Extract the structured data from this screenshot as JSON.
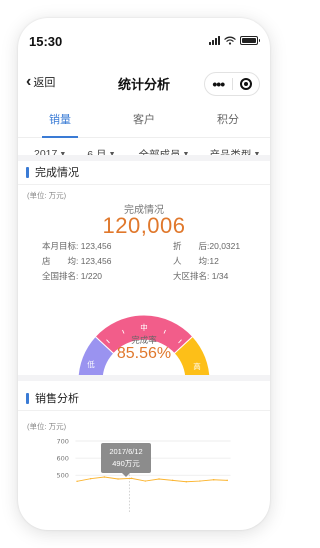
{
  "status_bar": {
    "time": "15:30"
  },
  "nav": {
    "back_label": "返回",
    "title": "统计分析",
    "more_glyph": "•••"
  },
  "tabs": [
    {
      "label": "销量",
      "active": true
    },
    {
      "label": "客户",
      "active": false
    },
    {
      "label": "积分",
      "active": false
    }
  ],
  "filters": [
    {
      "label": "2017"
    },
    {
      "label": "6 月"
    },
    {
      "label": "全部成员"
    },
    {
      "label": "产品类型"
    }
  ],
  "completion": {
    "section_title": "完成情况",
    "unit": "(单位: 万元)",
    "headline_label": "完成情况",
    "headline_value": "120,006",
    "stats": {
      "target_label": "本月目标:",
      "target_value": "123,456",
      "discount_label": "折　　后:",
      "discount_value": "20,0321",
      "store_avg_label": "店　　均:",
      "store_avg_value": "123,456",
      "per_capita_label": "人　　均:",
      "per_capita_value": "12",
      "national_rank_label": "全国排名:",
      "national_rank_value": "1/220",
      "region_rank_label": "大区排名:",
      "region_rank_value": "1/34"
    },
    "gauge": {
      "segments": [
        {
          "label": "低",
          "color": "#9a93f0"
        },
        {
          "label": "中",
          "color": "#f25d8a"
        },
        {
          "label": "高",
          "color": "#fdbf18"
        }
      ],
      "rate_label": "完成率",
      "rate_value": "85.56%",
      "rate": 0.8556
    }
  },
  "sales": {
    "section_title": "销售分析",
    "unit": "(单位: 万元)",
    "y_ticks": [
      "700",
      "600",
      "500"
    ],
    "tooltip": {
      "date": "2017/6/12",
      "value": "490万元"
    }
  },
  "chart_data": {
    "type": "line",
    "title": "",
    "ylabel": "(单位: 万元)",
    "ylim": [
      450,
      720
    ],
    "y_ticks": [
      500,
      600,
      700
    ],
    "series": [
      {
        "values": [
          465,
          480,
          490,
          478,
          482,
          466,
          478,
          470,
          462,
          466,
          474,
          470
        ]
      }
    ],
    "highlight": {
      "label": "2017/6/12",
      "value": 490
    },
    "line_color": "#fbb531"
  }
}
